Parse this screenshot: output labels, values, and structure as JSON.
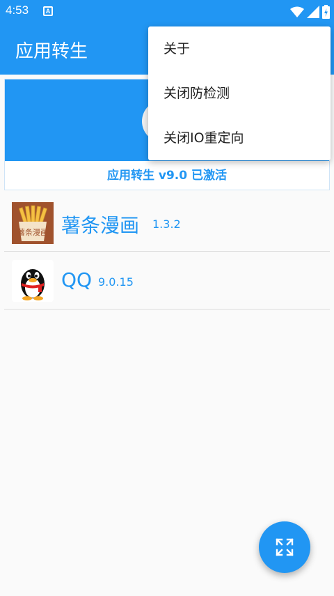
{
  "status_bar": {
    "time": "4:53",
    "notification_glyph": "A",
    "icons": [
      "wifi-icon",
      "signal-icon",
      "battery-charging-icon"
    ]
  },
  "app_bar": {
    "title": "应用转生"
  },
  "header": {
    "status_text": "应用转生 v9.0 已激活"
  },
  "apps": [
    {
      "name": "薯条漫画",
      "version": "1.3.2",
      "icon": "shutiao-manhua-app-icon",
      "icon_text": "薯条漫画"
    },
    {
      "name": "QQ",
      "version": "9.0.15",
      "icon": "qq-penguin-app-icon"
    }
  ],
  "menu": {
    "items": [
      {
        "label": "关于"
      },
      {
        "label": "关闭防检测"
      },
      {
        "label": "关闭IO重定向"
      }
    ]
  },
  "fab": {
    "icon": "expand-arrows-icon"
  },
  "colors": {
    "primary": "#2196f3",
    "background": "#fafafa",
    "text": "#212121"
  }
}
